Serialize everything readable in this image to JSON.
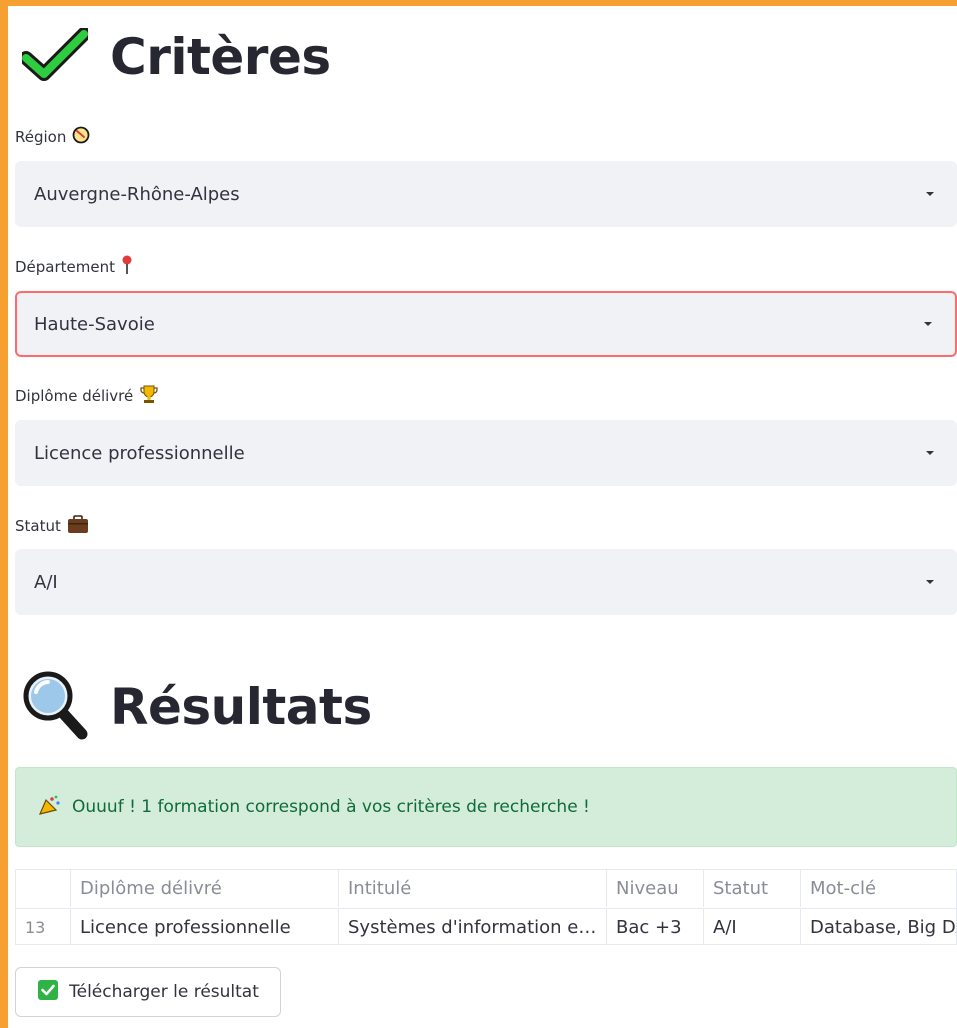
{
  "criteria": {
    "title": "Critères",
    "fields": {
      "region": {
        "label": "Région",
        "value": "Auvergne-Rhône-Alpes",
        "icon": "compass-icon"
      },
      "departement": {
        "label": "Département",
        "value": "Haute-Savoie",
        "icon": "pin-icon"
      },
      "diplome": {
        "label": "Diplôme délivré",
        "value": "Licence professionnelle",
        "icon": "trophy-icon"
      },
      "statut": {
        "label": "Statut",
        "value": "A/I",
        "icon": "briefcase-icon"
      }
    }
  },
  "results": {
    "title": "Résultats",
    "alert": "Ouuuf ! 1 formation correspond à vos critères de recherche !",
    "table": {
      "headers": [
        "",
        "Diplôme délivré",
        "Intitulé",
        "Niveau",
        "Statut",
        "Mot-clé"
      ],
      "rows": [
        [
          "13",
          "Licence professionnelle",
          "Systèmes d'information e…",
          "Bac +3",
          "A/I",
          "Database, Big DA"
        ]
      ]
    },
    "download_label": "Télécharger le résultat"
  },
  "colors": {
    "frame": "#f7a032",
    "focus_border": "#ff6b6b",
    "alert_bg": "#d4edda",
    "alert_text": "#0f6b3a"
  }
}
